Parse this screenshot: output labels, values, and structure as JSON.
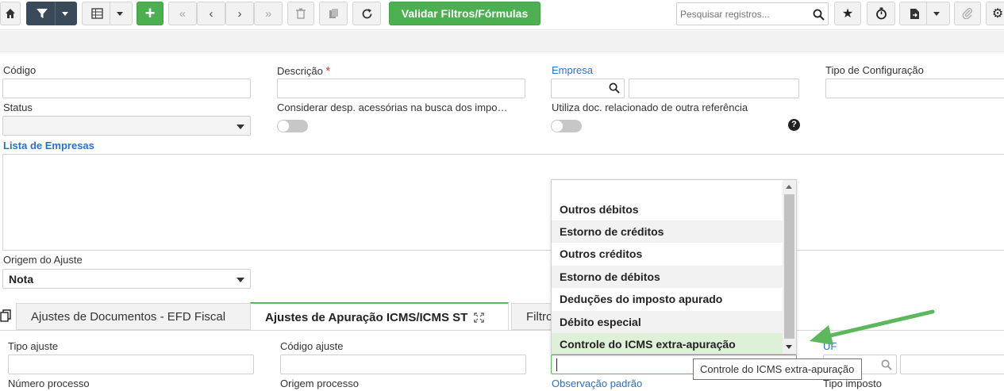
{
  "toolbar": {
    "validate_label": "Validar Filtros/Fórmulas",
    "search_placeholder": "Pesquisar registros..."
  },
  "form": {
    "codigo_label": "Código",
    "descricao_label": "Descrição",
    "required_mark": "*",
    "empresa_label": "Empresa",
    "tipo_config_label": "Tipo de Configuração",
    "status_label": "Status",
    "considerar_label": "Considerar desp. acessórias na busca dos impo…",
    "utiliza_doc_label": "Utiliza doc. relacionado de outra referência",
    "help_glyph": "?",
    "lista_empresas_label": "Lista de Empresas",
    "origem_ajuste_label": "Origem do Ajuste",
    "origem_ajuste_value": "Nota"
  },
  "tabs": [
    {
      "label": "Ajustes de Documentos - EFD Fiscal"
    },
    {
      "label": "Ajustes de Apuração ICMS/ICMS ST"
    },
    {
      "label": "Filtro"
    }
  ],
  "detail": {
    "tipo_ajuste_label": "Tipo ajuste",
    "codigo_ajuste_label": "Código ajuste",
    "uf_label": "UF",
    "numero_processo_label": "Número processo",
    "origem_processo_label": "Origem processo",
    "observacao_padrao_label": "Observação padrão",
    "tipo_imposto_label": "Tipo imposto"
  },
  "dropdown": {
    "options": [
      "Outros débitos",
      "Estorno de créditos",
      "Outros créditos",
      "Estorno de débitos",
      "Deduções do imposto apurado",
      "Débito especial",
      "Controle do ICMS extra-apuração"
    ],
    "selected": "Controle do ICMS extra-apuração"
  },
  "tooltip": "Controle do ICMS extra-apuração",
  "colors": {
    "accent_green": "#4caf50",
    "link_blue": "#2a6fd6",
    "arrow_green": "#5cb85c"
  }
}
